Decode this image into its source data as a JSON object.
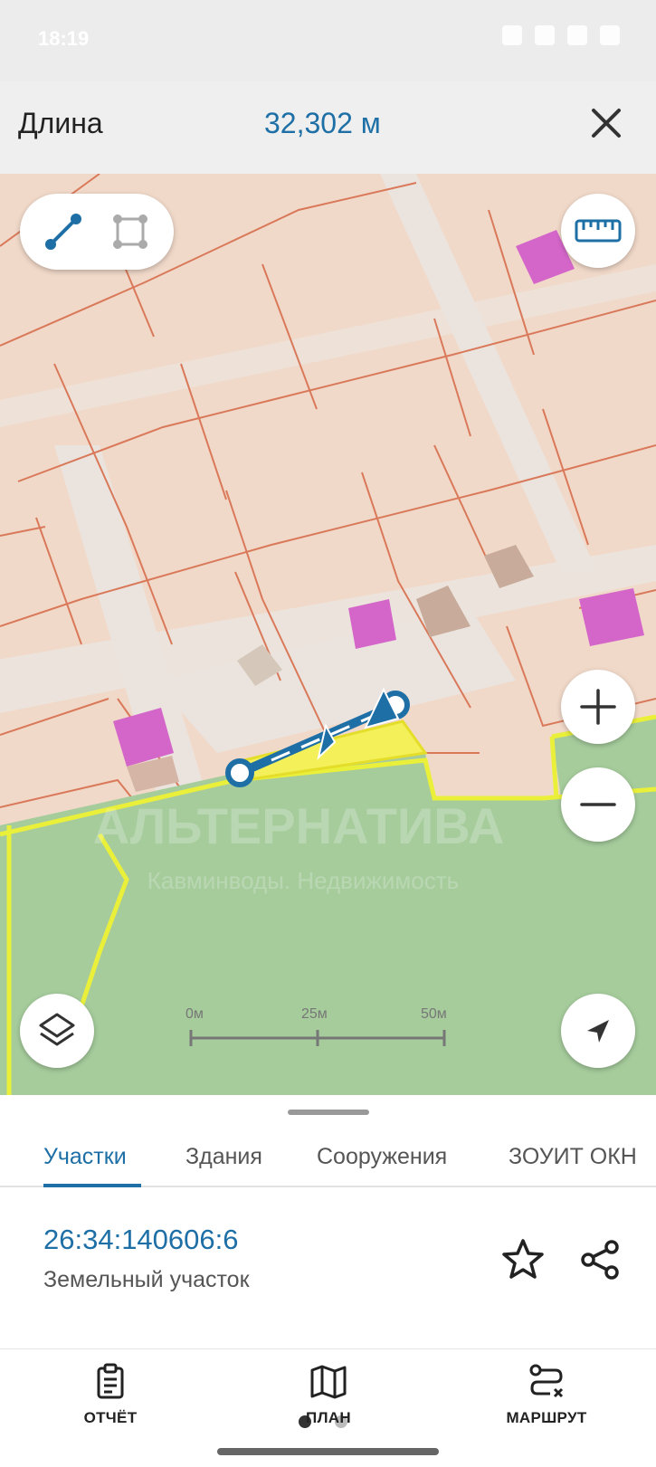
{
  "status": {
    "time": "18:19"
  },
  "measure": {
    "label": "Длина",
    "value": "32,302 м"
  },
  "map": {
    "scale_labels": [
      "0м",
      "25м",
      "50м"
    ],
    "watermark_title": "АЛЬТЕРНАТИВА",
    "watermark_subtitle": "Кавминводы. Недвижимость"
  },
  "tabs": [
    {
      "label": "Участки",
      "active": true
    },
    {
      "label": "Здания",
      "active": false
    },
    {
      "label": "Сооружения",
      "active": false
    },
    {
      "label": "ЗОУИТ ОКН",
      "active": false
    }
  ],
  "parcel": {
    "number": "26:34:140606:6",
    "type": "Земельный участок"
  },
  "bottom_nav": [
    {
      "label": "ОТЧЁТ",
      "icon": "report-icon"
    },
    {
      "label": "ПЛАН",
      "icon": "map-plan-icon"
    },
    {
      "label": "МАРШРУТ",
      "icon": "route-icon"
    }
  ],
  "colors": {
    "accent": "#1d6fa6",
    "parcel_fill": "#f1d9c9",
    "parcel_border": "#d9795a",
    "green_zone": "#a6cc9c",
    "highlight": "#f4f05a",
    "building_magenta": "#d466c9"
  }
}
